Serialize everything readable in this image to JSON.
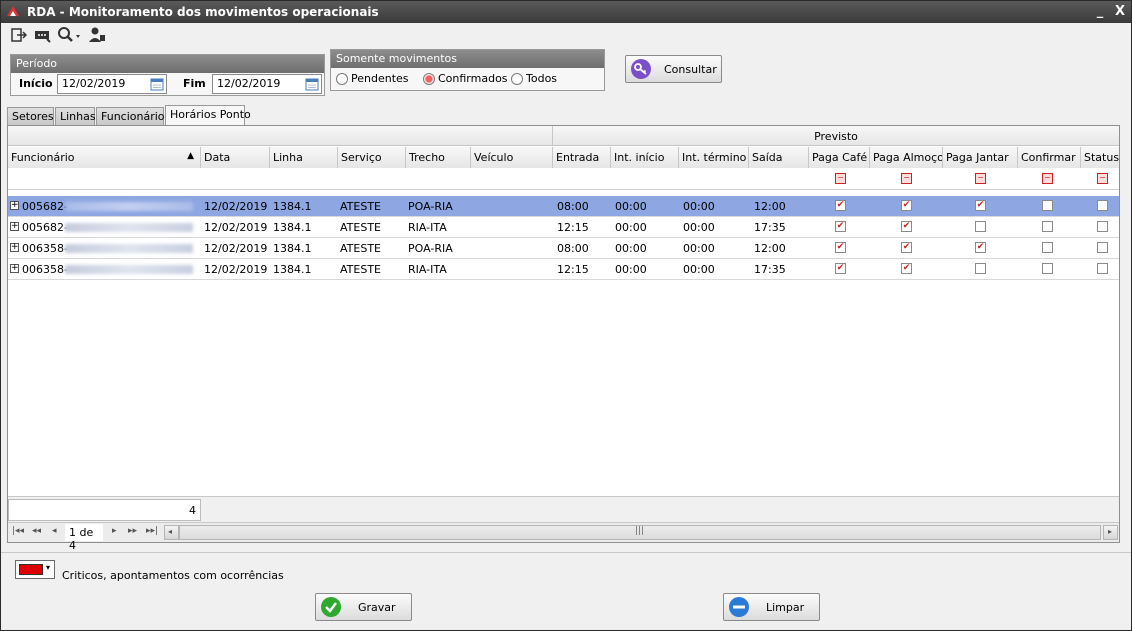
{
  "window": {
    "title": "RDA - Monitoramento dos movimentos operacionais",
    "minimize": "_",
    "close": "X"
  },
  "toolbar": {
    "icons": [
      "exit-icon",
      "message-icon",
      "search-dropdown-icon",
      "user-icon"
    ]
  },
  "periodo": {
    "title": "Período",
    "inicio_label": "Início",
    "inicio_value": "12/02/2019",
    "fim_label": "Fim",
    "fim_value": "12/02/2019"
  },
  "somente": {
    "title": "Somente movimentos",
    "options": [
      "Pendentes",
      "Confirmados",
      "Todos"
    ],
    "selected": "Confirmados"
  },
  "consultar_label": "Consultar",
  "tabs": [
    "Setores",
    "Linhas",
    "Funcionários",
    "Horários Ponto"
  ],
  "active_tab": "Horários Ponto",
  "grid": {
    "band_label": "Previsto",
    "columns": [
      "Funcionário",
      "Data",
      "Linha",
      "Serviço",
      "Trecho",
      "Veículo",
      "Entrada",
      "Int. início",
      "Int. término",
      "Saída",
      "Paga Café",
      "Paga Almoço",
      "Paga Jantar",
      "Confirmar",
      "Status"
    ],
    "sort_indicator": "▲",
    "rows": [
      {
        "funcionario": "005682-",
        "data": "12/02/2019",
        "linha": "1384.1",
        "servico": "ATESTE",
        "trecho": "POA-RIA",
        "veiculo": "",
        "entrada": "08:00",
        "int_inicio": "00:00",
        "int_termino": "00:00",
        "saida": "12:00",
        "paga_cafe": true,
        "paga_almoco": true,
        "paga_jantar": true,
        "confirmar": false,
        "status": false
      },
      {
        "funcionario": "005682-",
        "data": "12/02/2019",
        "linha": "1384.1",
        "servico": "ATESTE",
        "trecho": "RIA-ITA",
        "veiculo": "",
        "entrada": "12:15",
        "int_inicio": "00:00",
        "int_termino": "00:00",
        "saida": "17:35",
        "paga_cafe": true,
        "paga_almoco": true,
        "paga_jantar": false,
        "confirmar": false,
        "status": false
      },
      {
        "funcionario": "006358-",
        "data": "12/02/2019",
        "linha": "1384.1",
        "servico": "ATESTE",
        "trecho": "POA-RIA",
        "veiculo": "",
        "entrada": "08:00",
        "int_inicio": "00:00",
        "int_termino": "00:00",
        "saida": "12:00",
        "paga_cafe": true,
        "paga_almoco": true,
        "paga_jantar": true,
        "confirmar": false,
        "status": false
      },
      {
        "funcionario": "006358-",
        "data": "12/02/2019",
        "linha": "1384.1",
        "servico": "ATESTE",
        "trecho": "RIA-ITA",
        "veiculo": "",
        "entrada": "12:15",
        "int_inicio": "00:00",
        "int_termino": "00:00",
        "saida": "17:35",
        "paga_cafe": true,
        "paga_almoco": true,
        "paga_jantar": false,
        "confirmar": false,
        "status": false
      }
    ],
    "selected_row": 0,
    "count": "4",
    "pager_text": "1 de 4"
  },
  "legend": {
    "color": "#e00000",
    "text": "Criticos, apontamentos com ocorrências"
  },
  "buttons": {
    "gravar": "Gravar",
    "limpar": "Limpar"
  }
}
